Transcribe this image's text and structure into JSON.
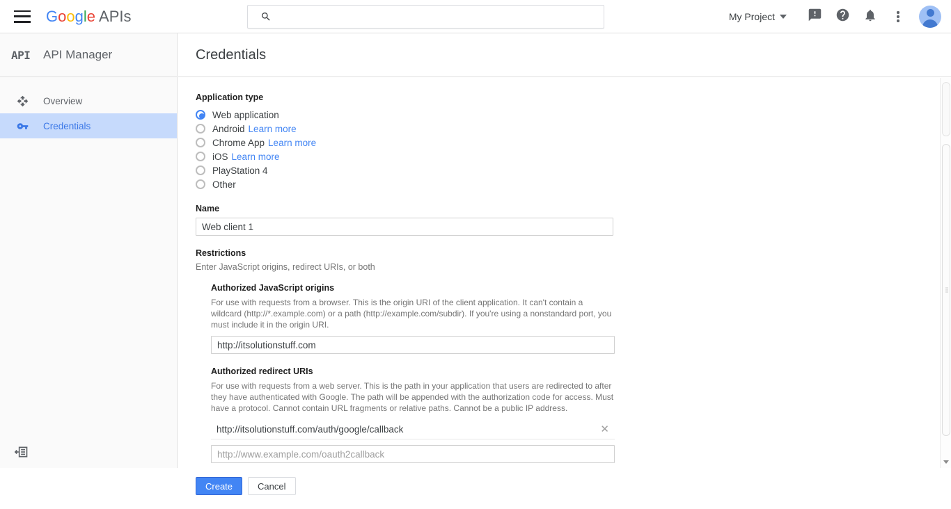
{
  "topbar": {
    "menu_icon": "hamburger-menu-icon",
    "brand": {
      "g": "G",
      "o1": "o",
      "o2": "o",
      "g_l": "g",
      "l": "l",
      "e": "e",
      "suffix": "APIs"
    },
    "search": {
      "value": "",
      "placeholder": "",
      "icon": "search-icon"
    },
    "project_selector": "My Project",
    "feedback_icon": "feedback-icon",
    "help_icon": "help-icon",
    "notifications_icon": "bell-icon",
    "more_icon": "more-vert-icon",
    "account_icon": "avatar-icon"
  },
  "sidebar": {
    "logo_text": "API",
    "title": "API Manager",
    "items": [
      {
        "label": "Overview",
        "icon": "dashboard-move-icon",
        "active": false
      },
      {
        "label": "Credentials",
        "icon": "key-icon",
        "active": true
      }
    ],
    "collapse_label": "collapse-sidebar-icon"
  },
  "page": {
    "title": "Credentials"
  },
  "form": {
    "application_type": {
      "label": "Application type",
      "options": [
        {
          "label": "Web application",
          "selected": true,
          "link": ""
        },
        {
          "label": "Android",
          "selected": false,
          "link": "Learn more"
        },
        {
          "label": "Chrome App",
          "selected": false,
          "link": "Learn more"
        },
        {
          "label": "iOS",
          "selected": false,
          "link": "Learn more"
        },
        {
          "label": "PlayStation 4",
          "selected": false,
          "link": ""
        },
        {
          "label": "Other",
          "selected": false,
          "link": ""
        }
      ]
    },
    "name": {
      "label": "Name",
      "value": "Web client 1",
      "placeholder": ""
    },
    "restrictions": {
      "label": "Restrictions",
      "hint": "Enter JavaScript origins, redirect URIs, or both"
    },
    "js_origins": {
      "label": "Authorized JavaScript origins",
      "description": "For use with requests from a browser. This is the origin URI of the client application. It can't contain a wildcard (http://*.example.com) or a path (http://example.com/subdir). If you're using a nonstandard port, you must include it in the origin URI.",
      "value": "http://itsolutionstuff.com",
      "placeholder": ""
    },
    "redirect_uris": {
      "label": "Authorized redirect URIs",
      "description": "For use with requests from a web server. This is the path in your application that users are redirected to after they have authenticated with Google. The path will be appended with the authorization code for access. Must have a protocol. Cannot contain URL fragments or relative paths. Cannot be a public IP address.",
      "entries": [
        {
          "value": "http://itsolutionstuff.com/auth/google/callback",
          "remove_icon": "close-icon"
        }
      ],
      "new_entry": {
        "value": "",
        "placeholder": "http://www.example.com/oauth2callback"
      }
    },
    "buttons": {
      "create": "Create",
      "cancel": "Cancel"
    }
  },
  "colors": {
    "accent": "#4285F4",
    "sidebar_active_bg": "#c6dafc",
    "sidebar_active_text": "#3b78e7",
    "link": "#4285F4"
  }
}
